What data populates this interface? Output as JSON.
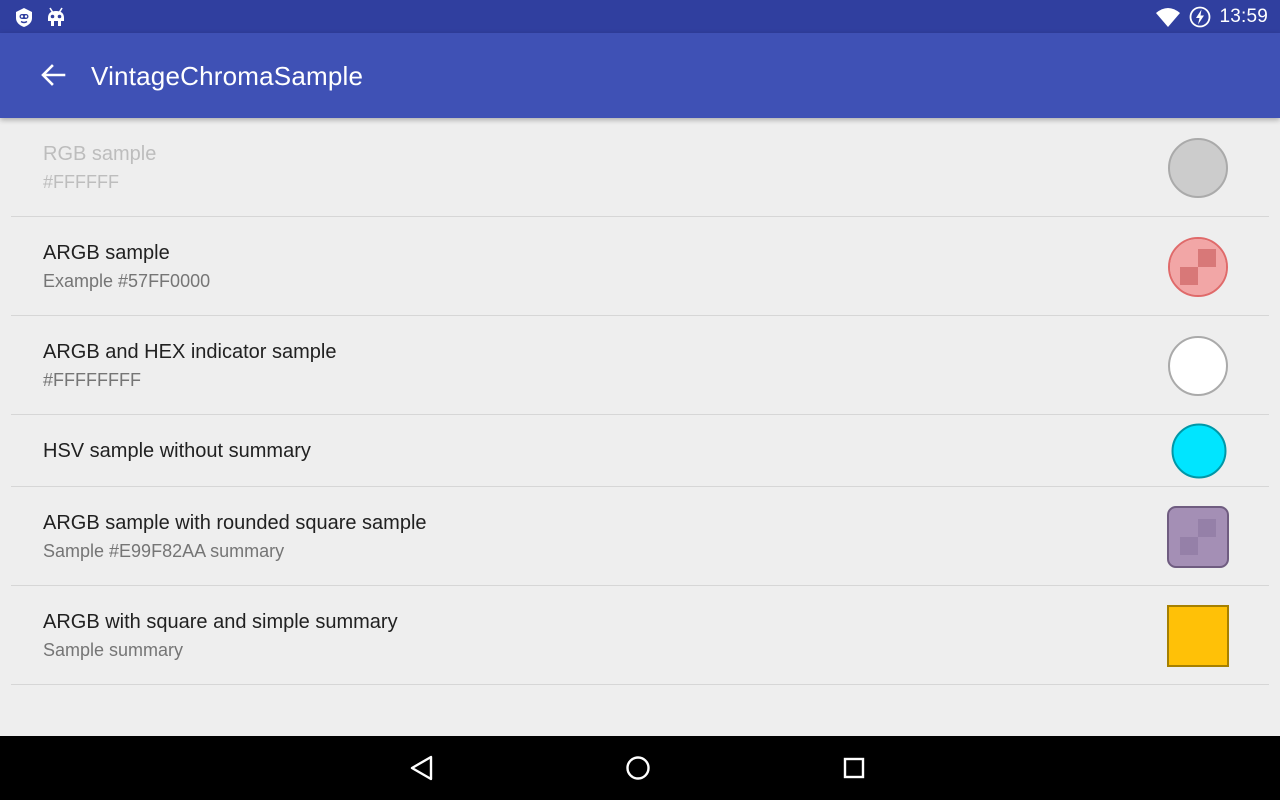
{
  "status_bar": {
    "time": "13:59",
    "left_icons": [
      "notification-app-icon",
      "android-debug-icon"
    ],
    "right_icons": [
      "wifi-icon",
      "battery-charging-icon"
    ]
  },
  "app_bar": {
    "back_icon": "arrow-back-icon",
    "title": "VintageChromaSample",
    "color": "#3f51b5",
    "status_color": "#303f9f"
  },
  "preferences": [
    {
      "title": "RGB sample",
      "summary": "#FFFFFF",
      "enabled": false,
      "swatch_shape": "circle",
      "swatch_color": "#cccccc"
    },
    {
      "title": "ARGB sample",
      "summary": "Example #57FF0000",
      "enabled": true,
      "swatch_shape": "circle",
      "swatch_color": "#57FF0000"
    },
    {
      "title": "ARGB and HEX indicator sample",
      "summary": "#FFFFFFFF",
      "enabled": true,
      "swatch_shape": "circle",
      "swatch_color": "#FFFFFFFF"
    },
    {
      "title": "HSV sample without summary",
      "summary": "",
      "enabled": true,
      "swatch_shape": "circle",
      "swatch_color": "#00e5ff"
    },
    {
      "title": "ARGB sample with rounded square sample",
      "summary": "Sample #E99F82AA summary",
      "enabled": true,
      "swatch_shape": "rounded-square",
      "swatch_color": "#E99F82AA"
    },
    {
      "title": "ARGB with square and simple summary",
      "summary": "Sample summary",
      "enabled": true,
      "swatch_shape": "square",
      "swatch_color": "#ffc107"
    }
  ],
  "nav_bar": {
    "icons": [
      "nav-back-icon",
      "nav-home-icon",
      "nav-recents-icon"
    ]
  }
}
